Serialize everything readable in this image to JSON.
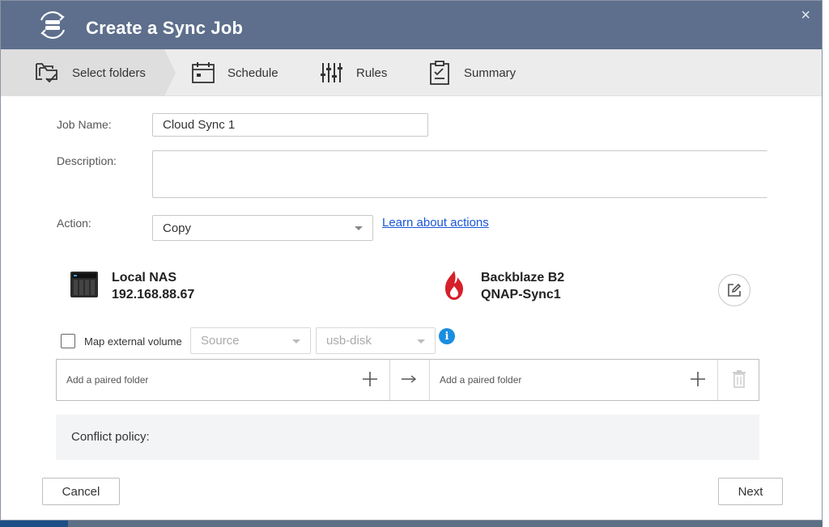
{
  "window": {
    "title": "Create a Sync Job",
    "close_label": "×"
  },
  "tabs": [
    {
      "label": "Select folders",
      "icon": "select-folders-icon",
      "active": true
    },
    {
      "label": "Schedule",
      "icon": "calendar-icon",
      "active": false
    },
    {
      "label": "Rules",
      "icon": "rules-sliders-icon",
      "active": false
    },
    {
      "label": "Summary",
      "icon": "clipboard-icon",
      "active": false
    }
  ],
  "form": {
    "job_name_label": "Job Name:",
    "job_name_value": "Cloud Sync 1",
    "description_label": "Description:",
    "description_value": "",
    "action_label": "Action:",
    "action_value": "Copy",
    "learn_link": "Learn about actions"
  },
  "source": {
    "name": "Local NAS",
    "address": "192.168.88.67",
    "icon": "nas-device-icon"
  },
  "destination": {
    "name": "Backblaze B2",
    "bucket": "QNAP-Sync1",
    "icon": "backblaze-flame-icon"
  },
  "external_volume": {
    "checkbox_label": "Map external volume",
    "checked": false,
    "source_placeholder": "Source",
    "disk_value": "usb-disk",
    "info_glyph": "i"
  },
  "pair": {
    "left_placeholder": "Add a paired folder",
    "right_placeholder": "Add a paired folder"
  },
  "conflict": {
    "label": "Conflict policy:"
  },
  "footer": {
    "cancel_label": "Cancel",
    "next_label": "Next"
  },
  "colors": {
    "titlebar": "#5d6f8c",
    "link": "#1a55d8",
    "info": "#1a8de0",
    "backblaze_red": "#d6202a"
  }
}
